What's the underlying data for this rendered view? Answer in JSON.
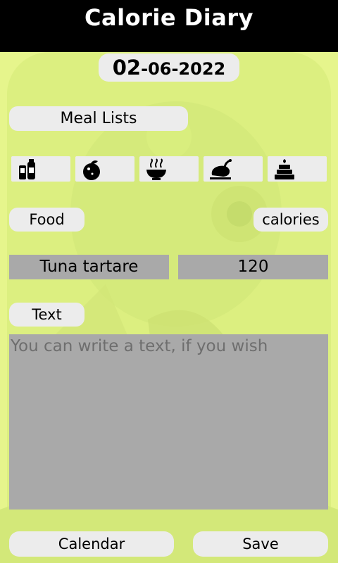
{
  "app": {
    "title": "Calorie Diary"
  },
  "date": {
    "day": "02",
    "rest": "-06-2022"
  },
  "meal_lists": {
    "label": "Meal Lists"
  },
  "meal_icons": [
    {
      "icon": "drinks-icon"
    },
    {
      "icon": "fruit-icon"
    },
    {
      "icon": "soup-bowl-icon"
    },
    {
      "icon": "roast-chicken-icon"
    },
    {
      "icon": "cake-icon"
    }
  ],
  "fields": {
    "food_label": "Food",
    "calories_label": "calories",
    "food_value": "Tuna tartare",
    "calories_value": "120",
    "text_label": "Text",
    "text_placeholder": "You can write a text, if you wish"
  },
  "buttons": {
    "calendar": "Calendar",
    "save": "Save"
  },
  "colors": {
    "background": "#e6f58c",
    "titlebar": "#000000",
    "pill": "#ececec",
    "field": "#a9a9a9"
  }
}
